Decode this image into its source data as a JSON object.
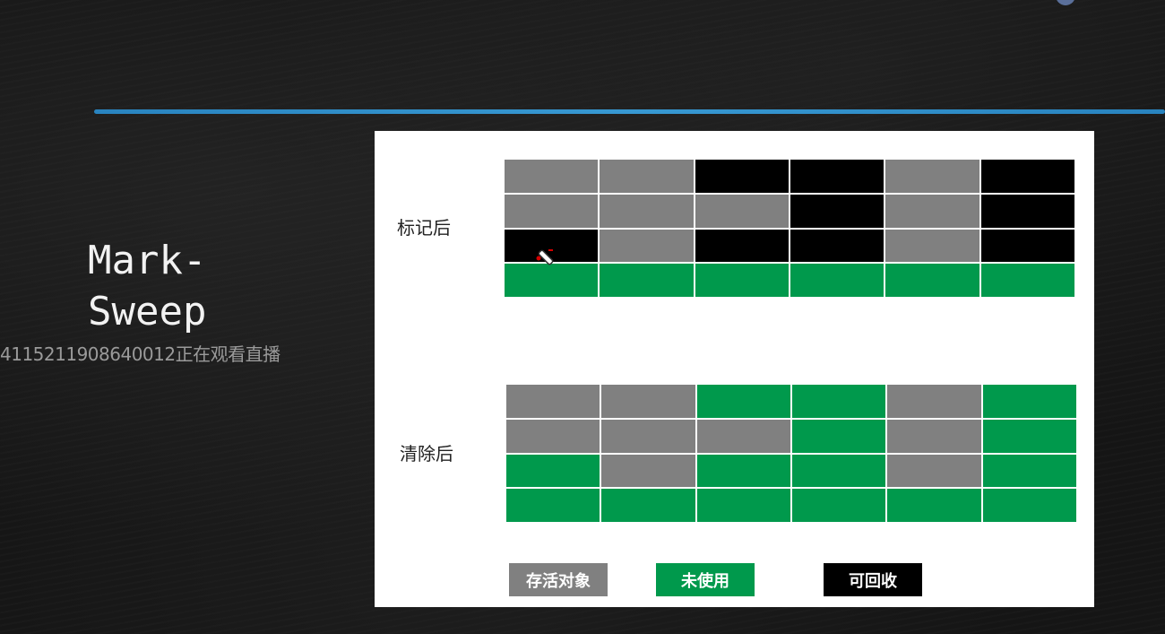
{
  "slide": {
    "title_line1": "Mark-",
    "title_line2": "Sweep",
    "viewer_notice": "4115211908640012正在观看直播"
  },
  "diagram": {
    "marked_label": "标记后",
    "swept_label": "清除后",
    "marked_grid": [
      [
        "live",
        "live",
        "reclaim",
        "reclaim",
        "live",
        "reclaim"
      ],
      [
        "live",
        "live",
        "live",
        "reclaim",
        "live",
        "reclaim"
      ],
      [
        "reclaim",
        "live",
        "reclaim",
        "reclaim",
        "live",
        "reclaim"
      ],
      [
        "free",
        "free",
        "free",
        "free",
        "free",
        "free"
      ]
    ],
    "swept_grid": [
      [
        "live",
        "live",
        "free",
        "free",
        "live",
        "free"
      ],
      [
        "live",
        "live",
        "live",
        "free",
        "live",
        "free"
      ],
      [
        "free",
        "live",
        "free",
        "free",
        "live",
        "free"
      ],
      [
        "free",
        "free",
        "free",
        "free",
        "free",
        "free"
      ]
    ],
    "legend": {
      "live": "存活对象",
      "free": "未使用",
      "reclaim": "可回收"
    },
    "colors": {
      "live": "#808080",
      "free": "#00994c",
      "reclaim": "#000000"
    }
  }
}
